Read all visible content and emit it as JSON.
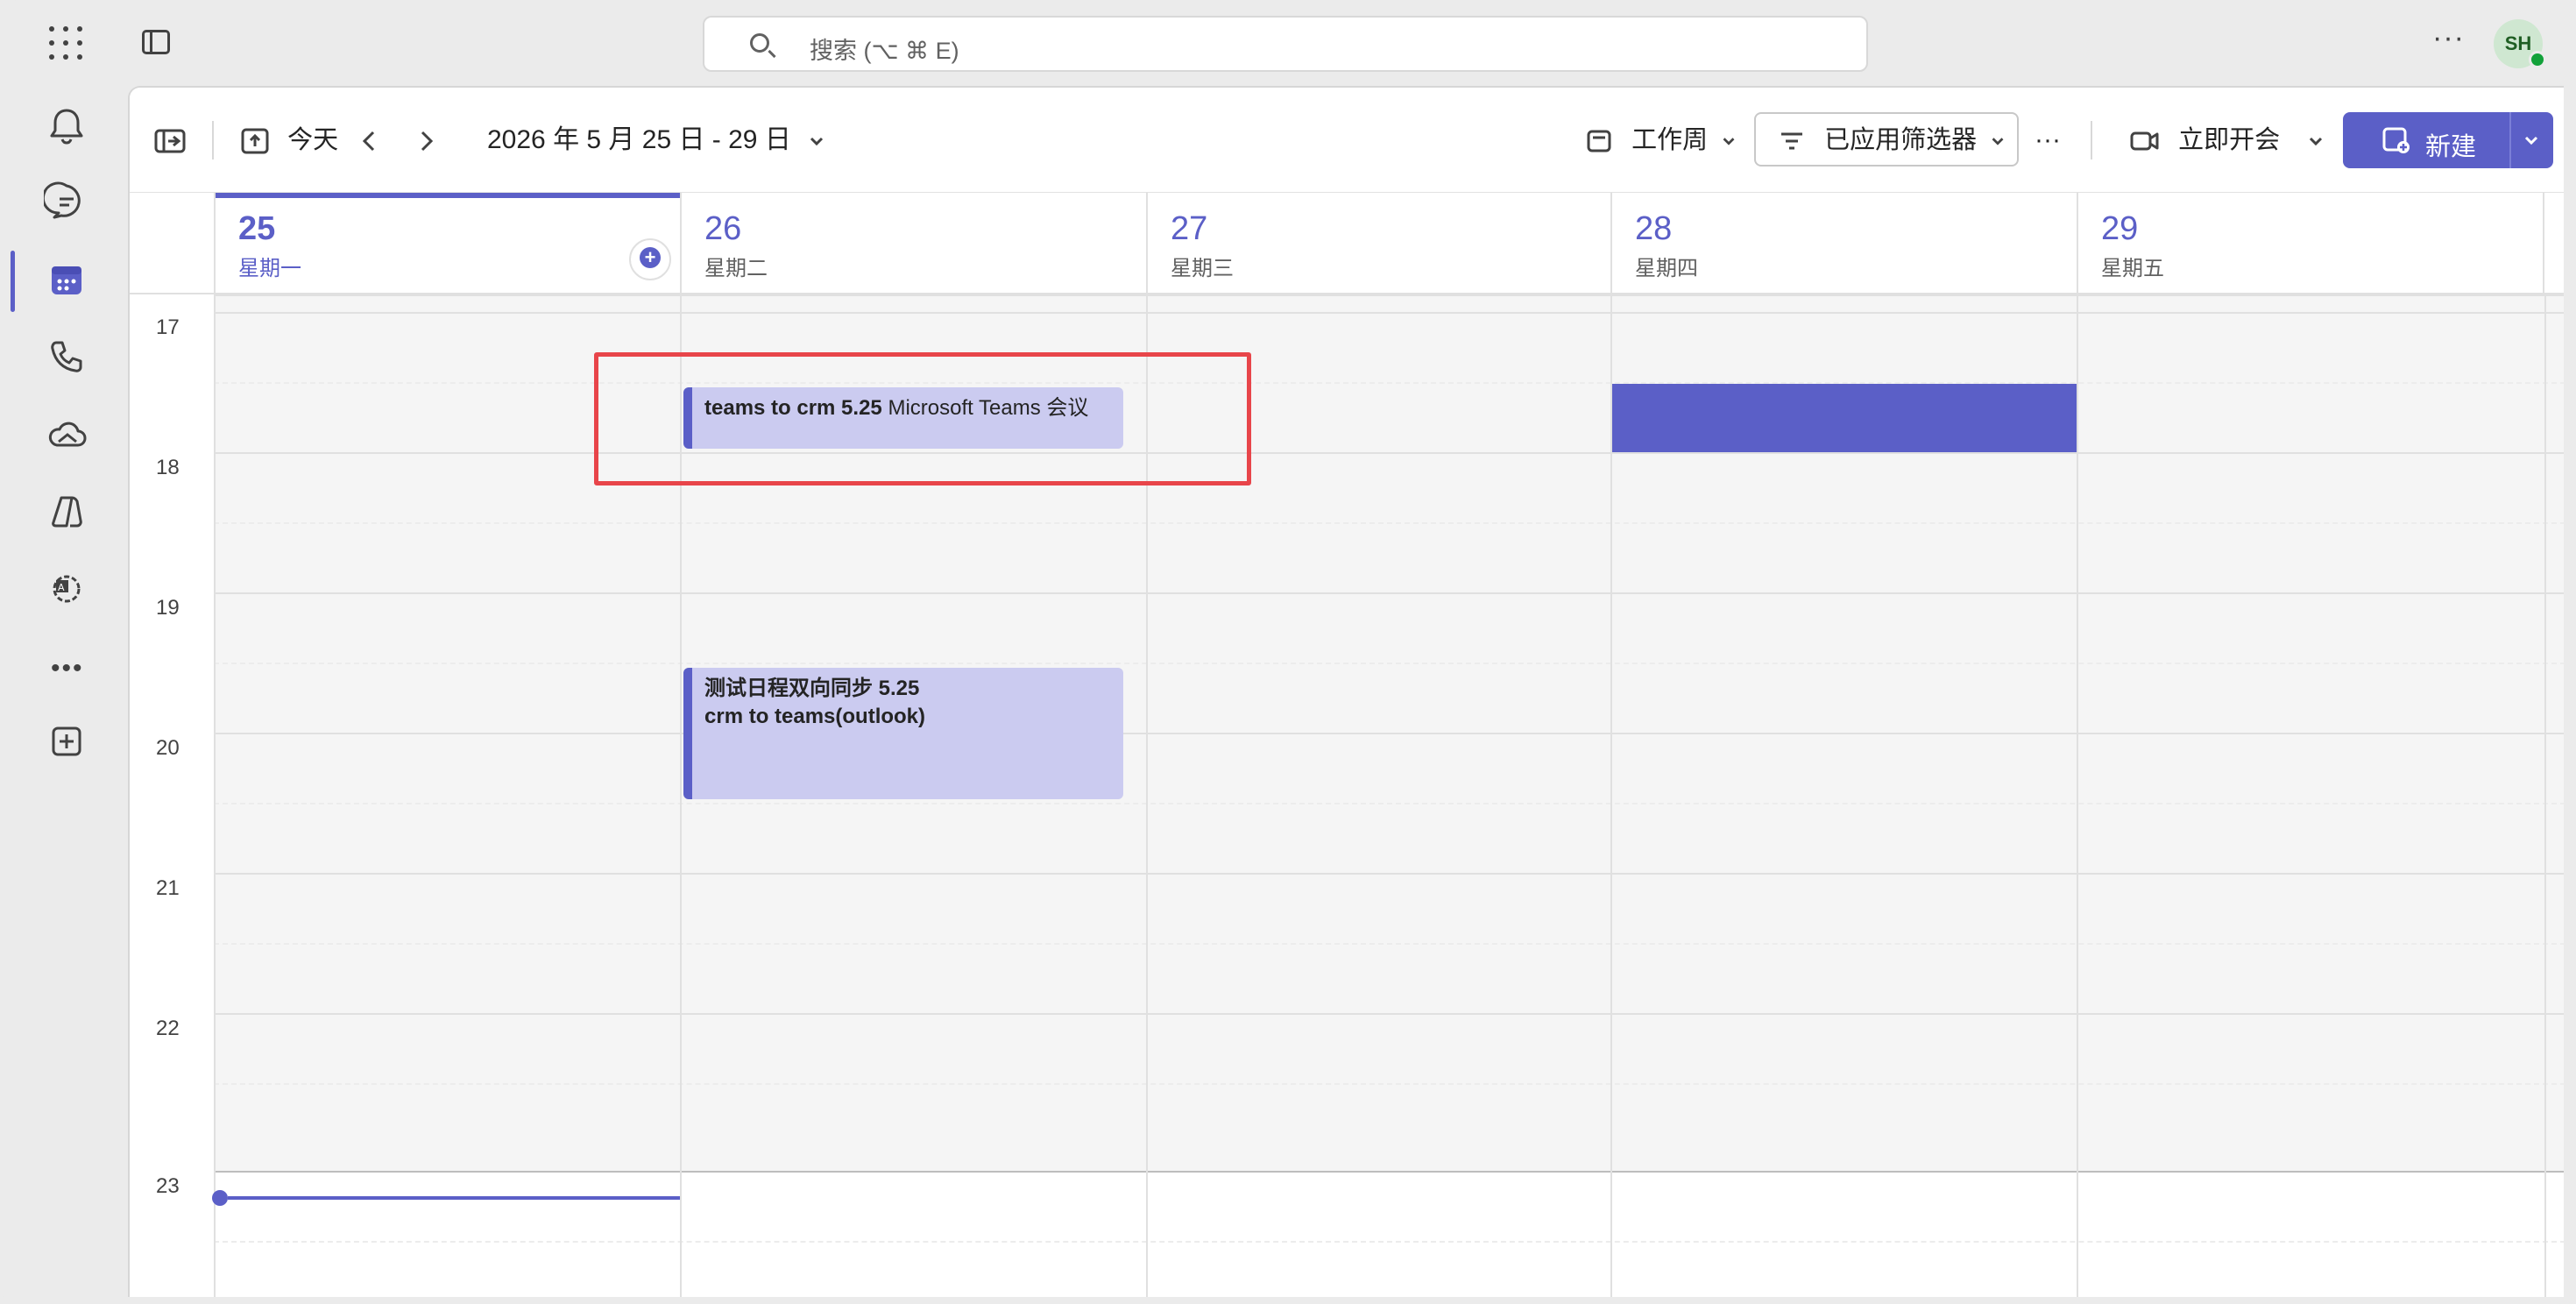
{
  "search": {
    "placeholder": "搜索 (⌥ ⌘ E)"
  },
  "user": {
    "initials": "SH"
  },
  "toolbar": {
    "today_label": "今天",
    "date_range": "2026 年 5 月 25 日 - 29 日",
    "view_label": "工作周",
    "filter_label": "已应用筛选器",
    "meet_now_label": "立即开会",
    "new_label": "新建"
  },
  "days": [
    {
      "num": "25",
      "name": "星期一"
    },
    {
      "num": "26",
      "name": "星期二"
    },
    {
      "num": "27",
      "name": "星期三"
    },
    {
      "num": "28",
      "name": "星期四"
    },
    {
      "num": "29",
      "name": "星期五"
    }
  ],
  "hours": [
    "17",
    "18",
    "19",
    "20",
    "21",
    "22",
    "23"
  ],
  "events": [
    {
      "title": "teams to crm 5.25",
      "detail": "Microsoft Teams 会议"
    },
    {
      "title": "测试日程双向同步 5.25",
      "detail": "crm to teams(outlook)"
    }
  ],
  "colors": {
    "accent": "#5b5fc7",
    "event_fill": "#cbcbf0",
    "highlight": "#e8454a"
  }
}
